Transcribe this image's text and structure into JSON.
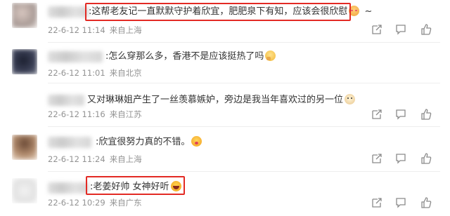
{
  "comments": [
    {
      "text": ":这帮老友记一直默默守护着欣宜，肥肥泉下有知，应该会很欣慰",
      "suffix": "~",
      "emoji": "blush-face",
      "timestamp": "22-6-12 11:14",
      "location": "来自上海"
    },
    {
      "text": ":怎么穿那么多，香港不是应该挺热了吗",
      "emoji": "thinking-face",
      "timestamp": "22-6-12 11:01",
      "location": "来自北京"
    },
    {
      "text": "又对琳琳姐产生了一丝羡慕嫉妒，旁边是我当年喜欢过的另一位",
      "emoji": "dog-face",
      "timestamp": "22-6-12 11:16",
      "location": "来自江苏"
    },
    {
      "text": ":欣宜很努力真的不错。",
      "emoji": "kiss-face",
      "timestamp": "22-6-12 11:24",
      "location": "来自上海"
    },
    {
      "text": ":老姜好帅 女神好听",
      "emoji": "laughing-face",
      "timestamp": "22-6-12 10:29",
      "location": "来自广东"
    }
  ],
  "actions": [
    "share-icon",
    "comment-icon",
    "like-icon"
  ],
  "colors": {
    "highlight": "#e32a24",
    "meta": "#939393",
    "text": "#333333"
  }
}
